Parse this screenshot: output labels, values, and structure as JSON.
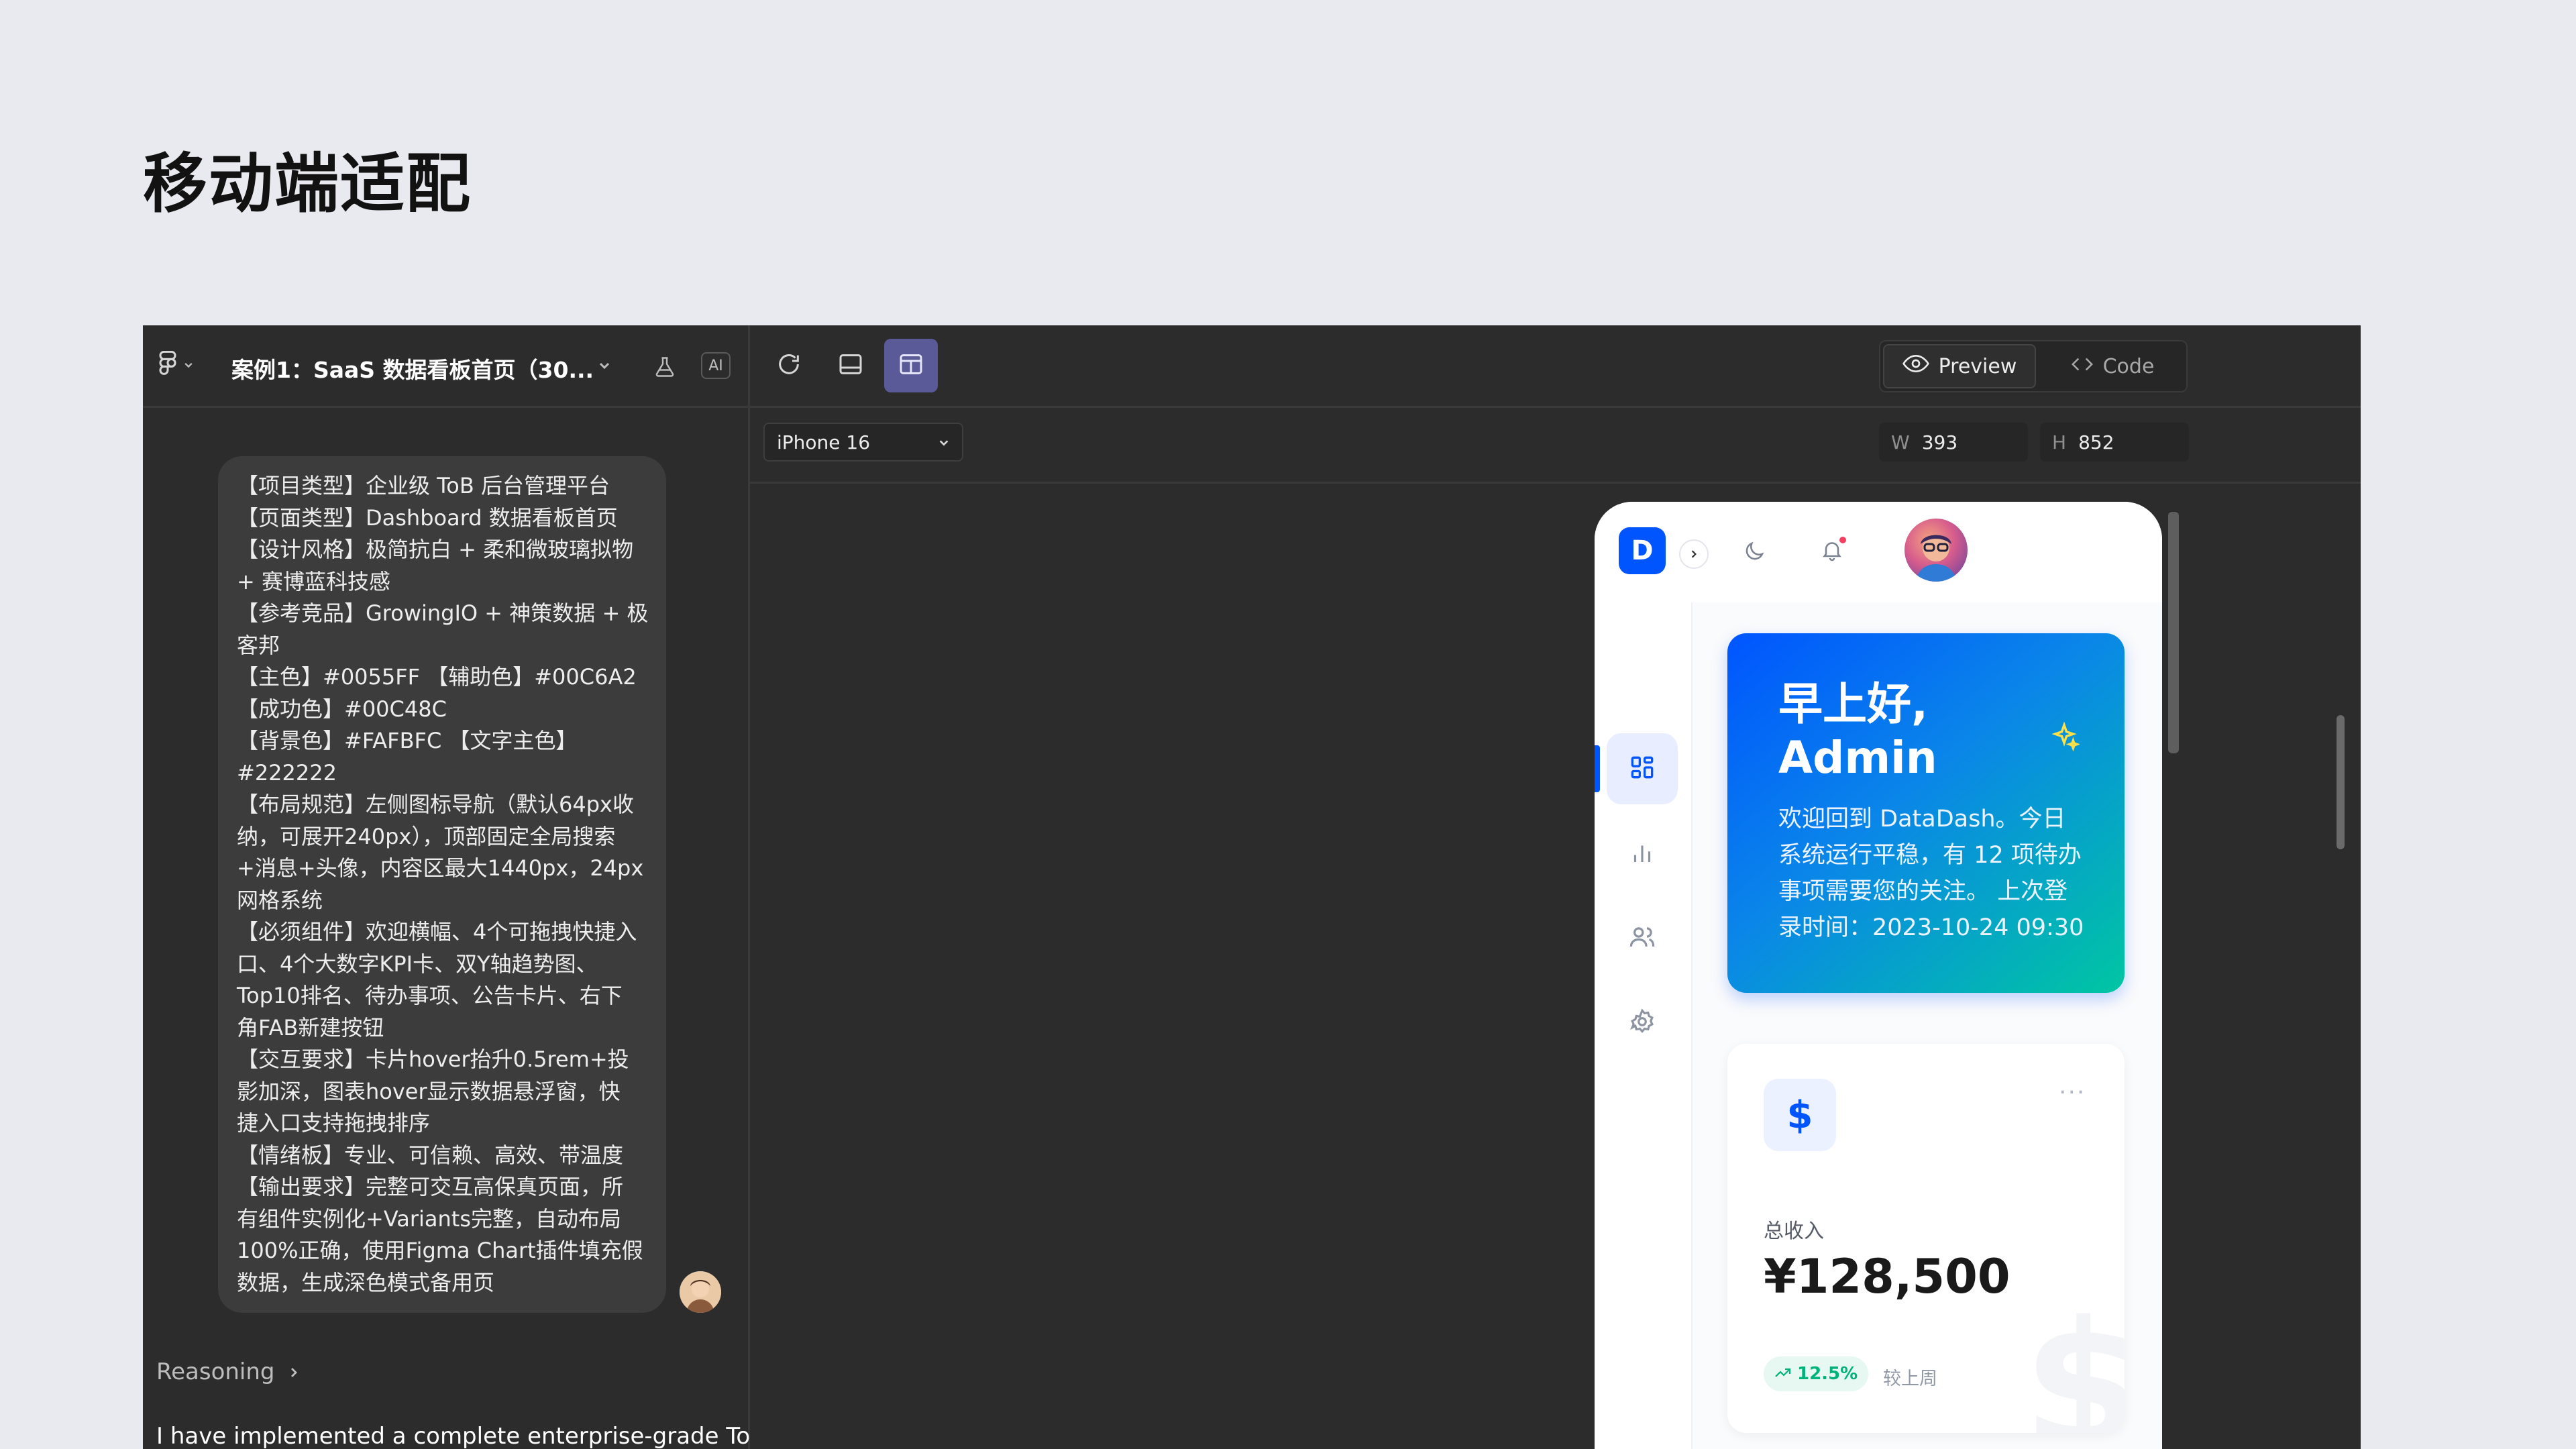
{
  "page": {
    "title": "移动端适配"
  },
  "left_panel": {
    "file_name": "案例1：SaaS 数据看板首页（30...",
    "ai_badge": "AI",
    "prompt_lines": [
      "【项目类型】企业级 ToB 后台管理平台",
      "【页面类型】Dashboard 数据看板首页",
      "【设计风格】极简抗白 + 柔和微玻璃拟物",
      "+ 赛博蓝科技感",
      "【参考竞品】GrowingIO + 神策数据 + 极",
      "客邦",
      "【主色】#0055FF 【辅助色】#00C6A2",
      "【成功色】#00C48C",
      "【背景色】#FAFBFC 【文字主色】",
      "#222222",
      "【布局规范】左侧图标导航（默认64px收",
      "纳，可展开240px），顶部固定全局搜索",
      "+消息+头像，内容区最大1440px，24px",
      "网格系统",
      "【必须组件】欢迎横幅、4个可拖拽快捷入",
      "口、4个大数字KPI卡、双Y轴趋势图、",
      "Top10排名、待办事项、公告卡片、右下",
      "角FAB新建按钮",
      "【交互要求】卡片hover抬升0.5rem+投",
      "影加深，图表hover显示数据悬浮窗，快",
      "捷入口支持拖拽排序",
      "【情绪板】专业、可信赖、高效、带温度",
      "【输出要求】完整可交互高保真页面，所",
      "有组件实例化+Variants完整，自动布局",
      "100%正确，使用Figma Chart插件填充假",
      "数据，生成深色模式备用页"
    ],
    "reasoning_label": "Reasoning",
    "answer_text": "I have implemented a complete enterprise-grade ToB"
  },
  "toolbar": {
    "preview_label": "Preview",
    "code_label": "Code",
    "device": "iPhone 16",
    "width_label": "W",
    "width_value": "393",
    "height_label": "H",
    "height_value": "852"
  },
  "phone": {
    "logo_letter": "D",
    "hero": {
      "title_line1": "早上好,",
      "title_line2": "Admin",
      "text": "欢迎回到 DataDash。今日系统运行平稳，有 12 项待办事项需要您的关注。 上次登录时间：2023-10-24 09:30"
    },
    "kpi": {
      "icon": "$",
      "more": "···",
      "label": "总收入",
      "value": "¥128,500",
      "trend": "12.5%",
      "trend_note": "较上周"
    }
  },
  "colors": {
    "primary": "#0055FF",
    "accent": "#00C6A2",
    "success": "#00C48C",
    "canvas": "#2C2C2C",
    "page_bg": "#E9EAEF"
  },
  "icons": [
    "figma-icon",
    "chevron-down-icon",
    "flask-icon",
    "refresh-icon",
    "panel-bottom-icon",
    "panel-split-icon",
    "eye-icon",
    "code-icon",
    "chevron-right-icon",
    "moon-icon",
    "bell-icon",
    "grid-icon",
    "bar-chart-icon",
    "users-icon",
    "gear-icon",
    "sparkle-icon",
    "trend-up-icon",
    "dollar-icon"
  ]
}
